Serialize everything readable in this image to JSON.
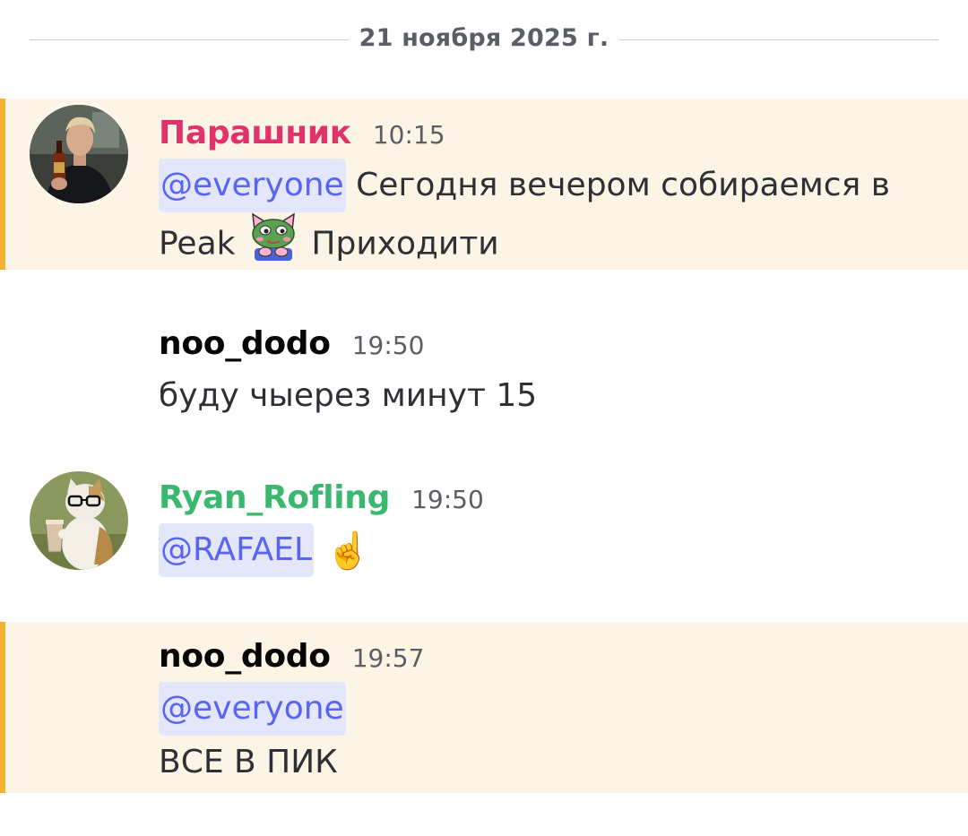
{
  "date_divider": "21 ноября 2025 г.",
  "colors": {
    "mention_bg": "#e4e7fb",
    "mention_text": "#5865f2",
    "highlight_bg": "#fcf5e5",
    "highlight_bar": "#f0b232",
    "username_parashnik": "#e0336c",
    "username_ryan": "#3bb86f",
    "username_noo": "#060607"
  },
  "messages": [
    {
      "username": "Парашник",
      "time": "10:15",
      "mention": "@everyone",
      "text_after_mention": "Сегодня вечером собираемся в",
      "text_line2_before_emoji": "Peak",
      "emoji": "pepe-cat-emoji",
      "text_line2_after_emoji": "Приходити"
    },
    {
      "username": "noo_dodo",
      "time": "19:50",
      "text": "буду чыерез минут 15"
    },
    {
      "username": "Ryan_Rofling",
      "time": "19:50",
      "mention": "@RAFAEL",
      "emoji": "☝️"
    },
    {
      "username": "noo_dodo",
      "time": "19:57",
      "mention": "@everyone",
      "text": "ВСЕ В ПИК"
    }
  ]
}
